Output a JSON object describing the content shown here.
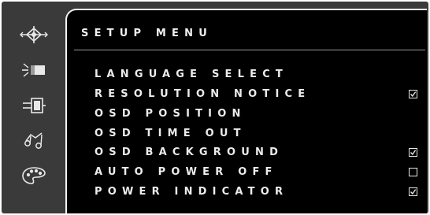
{
  "window": {
    "title": "SETUP MENU"
  },
  "sidebar": {
    "icons": [
      {
        "name": "picture-adjust-icon"
      },
      {
        "name": "input-source-icon"
      },
      {
        "name": "video-connector-icon"
      },
      {
        "name": "audio-icon"
      },
      {
        "name": "color-palette-icon"
      }
    ]
  },
  "menu": {
    "items": [
      {
        "label": "LANGUAGE SELECT",
        "has_checkbox": false
      },
      {
        "label": "RESOLUTION NOTICE",
        "has_checkbox": true,
        "checked": true
      },
      {
        "label": "OSD POSITION",
        "has_checkbox": false
      },
      {
        "label": "OSD TIME OUT",
        "has_checkbox": false
      },
      {
        "label": "OSD BACKGROUND",
        "has_checkbox": true,
        "checked": true
      },
      {
        "label": "AUTO POWER OFF",
        "has_checkbox": true,
        "checked": false
      },
      {
        "label": "POWER INDICATOR",
        "has_checkbox": true,
        "checked": true
      }
    ]
  },
  "colors": {
    "frame": "#3a3a3a",
    "panel": "#000000",
    "text": "#ececec",
    "border": "#f2f2f2"
  }
}
